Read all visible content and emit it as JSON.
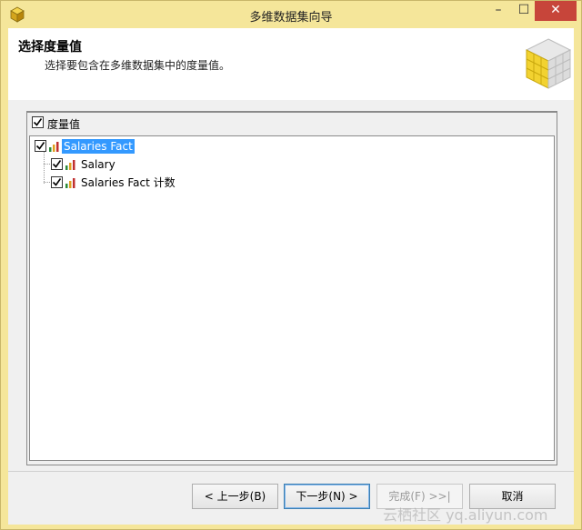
{
  "window": {
    "title": "多维数据集向导",
    "min_glyph": "–",
    "max_glyph": "☐",
    "close_glyph": "✕"
  },
  "header": {
    "title": "选择度量值",
    "subtitle": "选择要包含在多维数据集中的度量值。"
  },
  "panel": {
    "label": "度量值",
    "checked": true,
    "tree": [
      {
        "label": "Salaries Fact",
        "checked": true,
        "selected": true,
        "icon": "measure-group-bar-icon",
        "children": [
          {
            "label": "Salary",
            "checked": true,
            "icon": "measure-bar-icon"
          },
          {
            "label": "Salaries Fact 计数",
            "checked": true,
            "icon": "measure-bar-icon"
          }
        ]
      }
    ]
  },
  "buttons": {
    "back": "< 上一步(B)",
    "next": "下一步(N) >",
    "finish": "完成(F) >>|",
    "cancel": "取消"
  },
  "watermark": "云栖社区 yq.aliyun.com",
  "colors": {
    "selection": "#3399ff",
    "title_bar": "#f5e69a",
    "close_button": "#c7453a"
  }
}
